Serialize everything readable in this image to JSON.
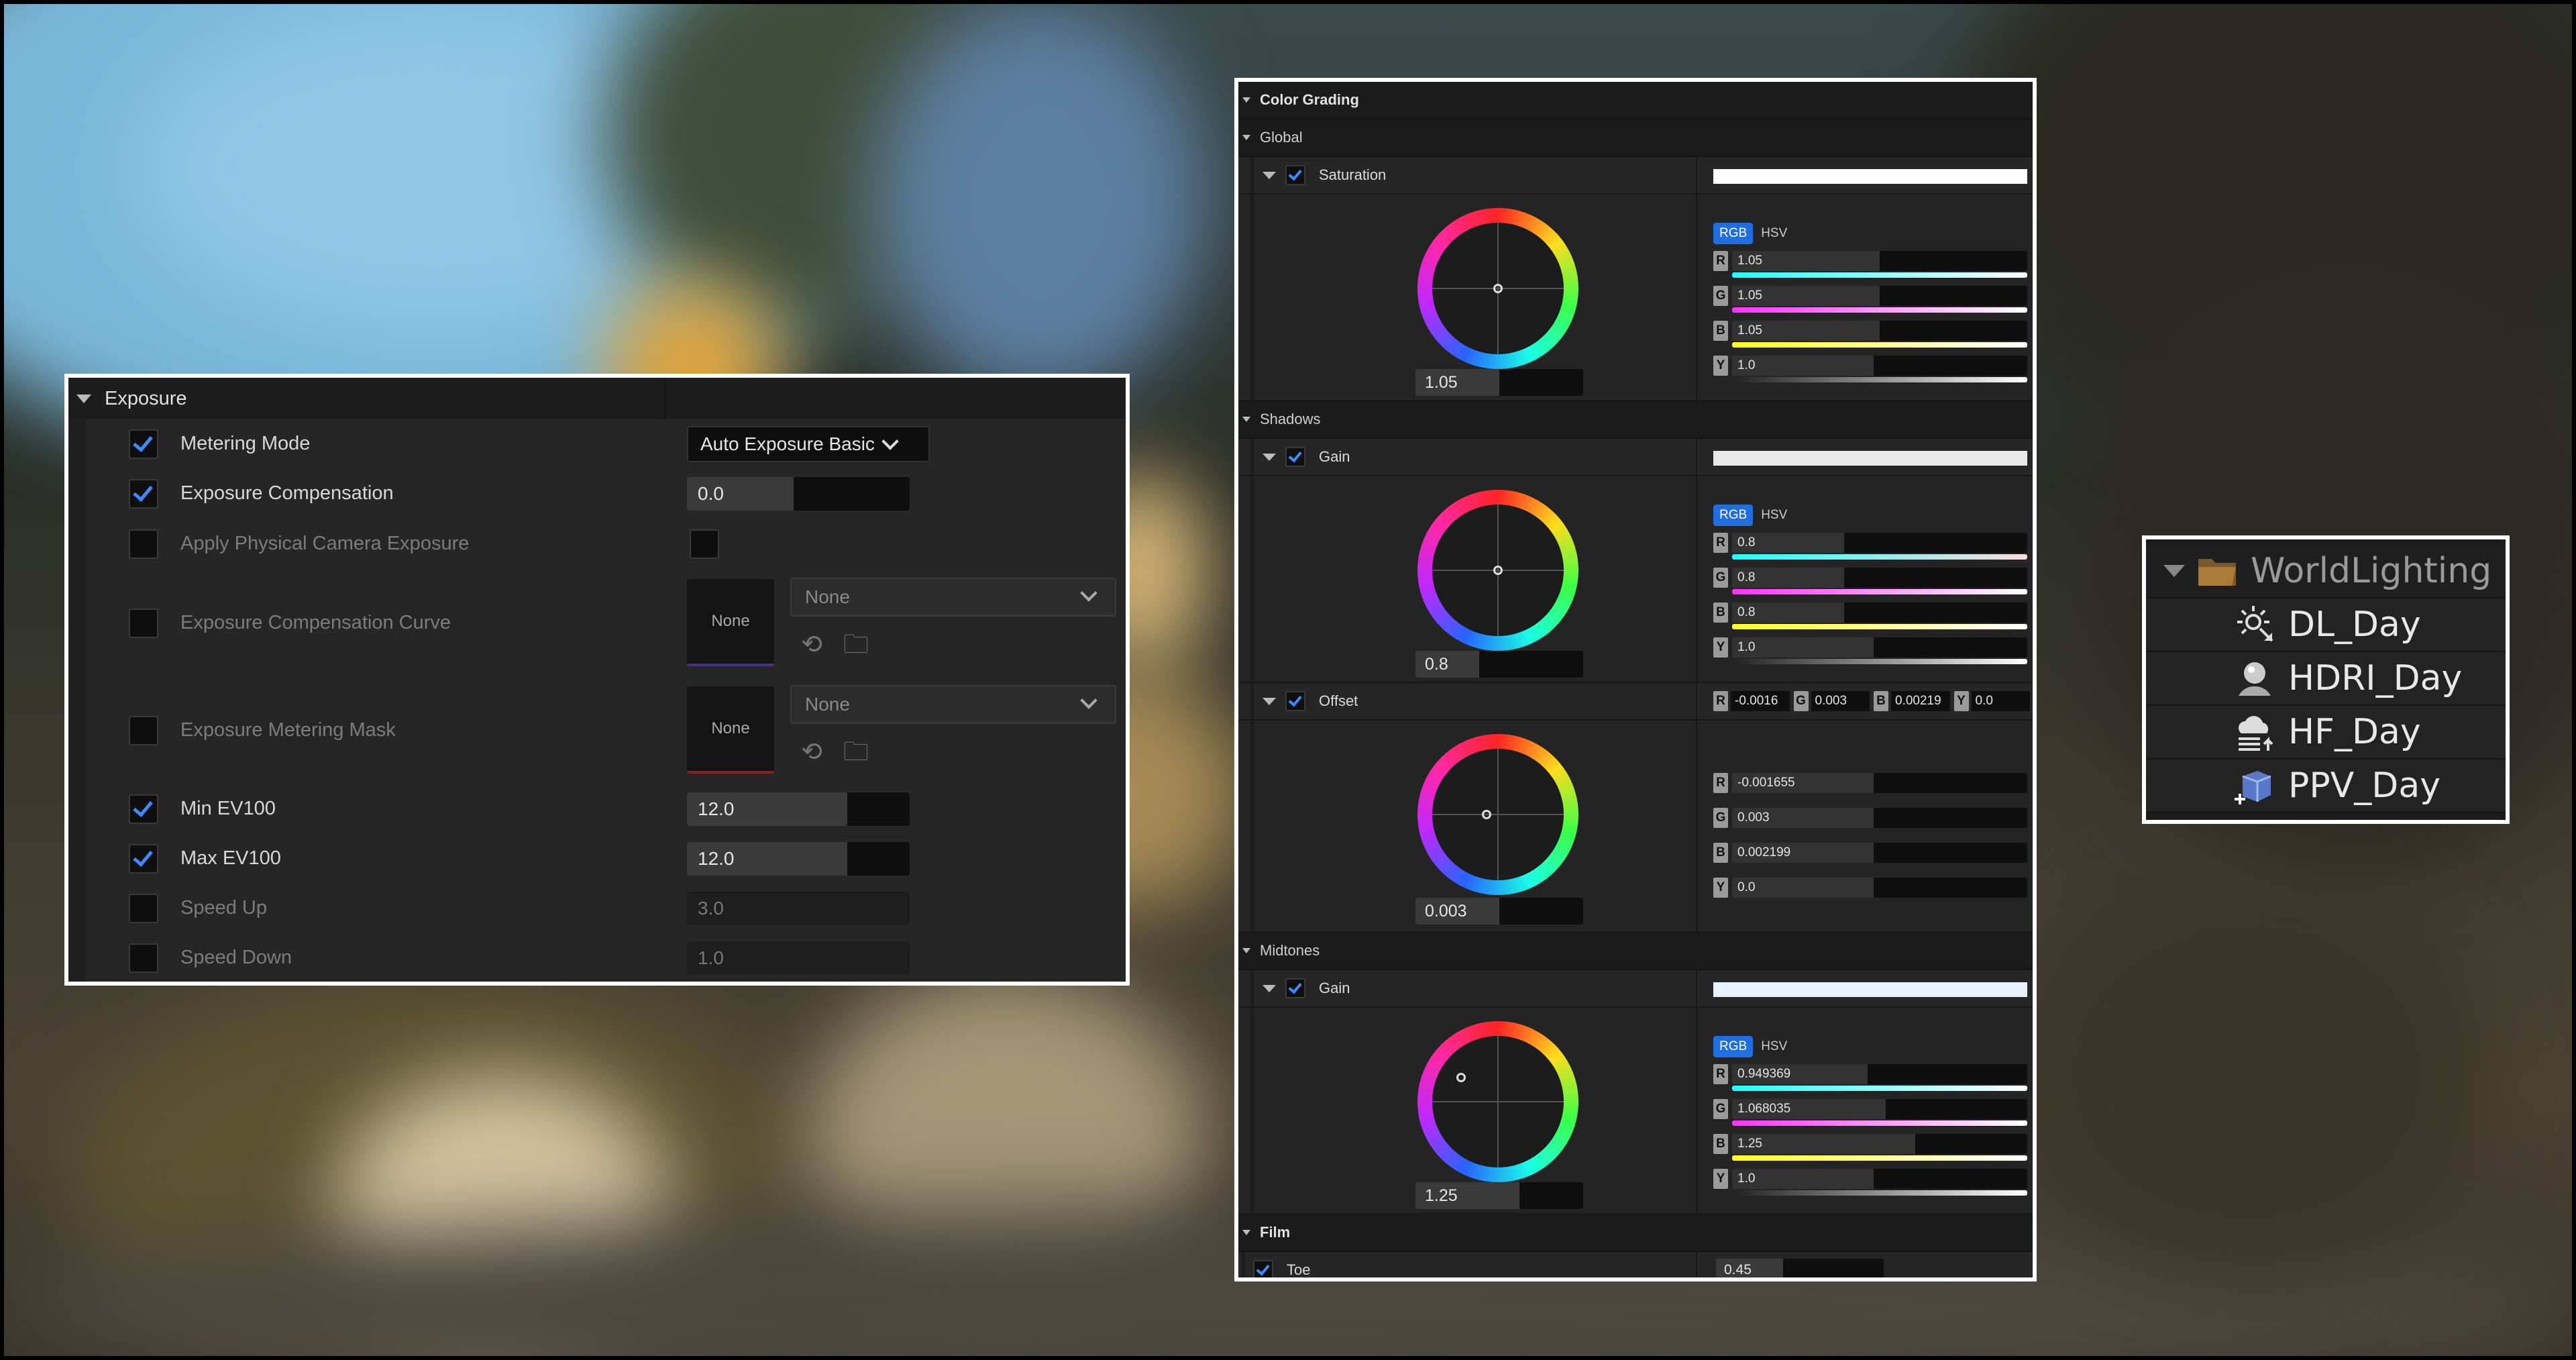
{
  "exposure": {
    "title": "Exposure",
    "rows": [
      {
        "label": "Metering Mode",
        "checked": true,
        "enabled": true,
        "value": "Auto Exposure Basic",
        "kind": "combo"
      },
      {
        "label": "Exposure Compensation",
        "checked": true,
        "enabled": true,
        "value": "0.0",
        "kind": "number",
        "fill": 0.48
      },
      {
        "label": "Apply Physical Camera Exposure",
        "checked": false,
        "enabled": false,
        "kind": "checkbox"
      },
      {
        "label": "Exposure Compensation Curve",
        "checked": false,
        "enabled": false,
        "kind": "asset",
        "thumb": "None",
        "dropdown": "None"
      },
      {
        "label": "Exposure Metering Mask",
        "checked": false,
        "enabled": false,
        "kind": "asset",
        "thumb": "None",
        "dropdown": "None"
      },
      {
        "label": "Min EV100",
        "checked": true,
        "enabled": true,
        "value": "12.0",
        "kind": "number",
        "fill": 0.72
      },
      {
        "label": "Max EV100",
        "checked": true,
        "enabled": true,
        "value": "12.0",
        "kind": "number",
        "fill": 0.72
      },
      {
        "label": "Speed Up",
        "checked": false,
        "enabled": false,
        "value": "3.0",
        "kind": "number"
      },
      {
        "label": "Speed Down",
        "checked": false,
        "enabled": false,
        "value": "1.0",
        "kind": "number"
      }
    ]
  },
  "color_grading": {
    "title": "Color Grading",
    "mode_rgb": "RGB",
    "mode_hsv": "HSV",
    "sections": {
      "global": "Global",
      "shadows": "Shadows",
      "midtones": "Midtones",
      "film": "Film"
    },
    "global_saturation": {
      "label": "Saturation",
      "wheel_value": "1.05",
      "wheel_fill": 0.5,
      "channels": [
        {
          "key": "R",
          "value": "1.05",
          "fill": 0.5
        },
        {
          "key": "G",
          "value": "1.05",
          "fill": 0.5
        },
        {
          "key": "B",
          "value": "1.05",
          "fill": 0.5
        },
        {
          "key": "Y",
          "value": "1.0",
          "fill": 0.48
        }
      ]
    },
    "shadows_gain": {
      "label": "Gain",
      "wheel_value": "0.8",
      "wheel_fill": 0.38,
      "channels": [
        {
          "key": "R",
          "value": "0.8",
          "fill": 0.38
        },
        {
          "key": "G",
          "value": "0.8",
          "fill": 0.38
        },
        {
          "key": "B",
          "value": "0.8",
          "fill": 0.38
        },
        {
          "key": "Y",
          "value": "1.0",
          "fill": 0.48
        }
      ]
    },
    "shadows_offset": {
      "label": "Offset",
      "wheel_value": "0.003",
      "wheel_fill": 0.5,
      "inline": [
        {
          "key": "R",
          "value": "-0.0016"
        },
        {
          "key": "G",
          "value": "0.003"
        },
        {
          "key": "B",
          "value": "0.00219"
        },
        {
          "key": "Y",
          "value": "0.0"
        }
      ],
      "channels": [
        {
          "key": "R",
          "value": "-0.001655",
          "fill": 0.48
        },
        {
          "key": "G",
          "value": "0.003",
          "fill": 0.48
        },
        {
          "key": "B",
          "value": "0.002199",
          "fill": 0.48
        },
        {
          "key": "Y",
          "value": "0.0",
          "fill": 0.48
        }
      ]
    },
    "midtones_gain": {
      "label": "Gain",
      "wheel_value": "1.25",
      "wheel_fill": 0.62,
      "channels": [
        {
          "key": "R",
          "value": "0.949369",
          "fill": 0.46
        },
        {
          "key": "G",
          "value": "1.068035",
          "fill": 0.52
        },
        {
          "key": "B",
          "value": "1.25",
          "fill": 0.62
        },
        {
          "key": "Y",
          "value": "1.0",
          "fill": 0.48
        }
      ]
    },
    "film_toe": {
      "label": "Toe",
      "value": "0.45",
      "fill": 0.4
    }
  },
  "outliner": {
    "folder": "WorldLighting",
    "items": [
      {
        "label": "DL_Day",
        "icon": "directional-light-icon"
      },
      {
        "label": "HDRI_Day",
        "icon": "hdri-backdrop-icon"
      },
      {
        "label": "HF_Day",
        "icon": "height-fog-icon"
      },
      {
        "label": "PPV_Day",
        "icon": "post-process-volume-icon"
      }
    ]
  },
  "colors": {
    "accent": "#1f6fe0",
    "check": "#3d8bff",
    "panel_border": "#ffffff"
  }
}
